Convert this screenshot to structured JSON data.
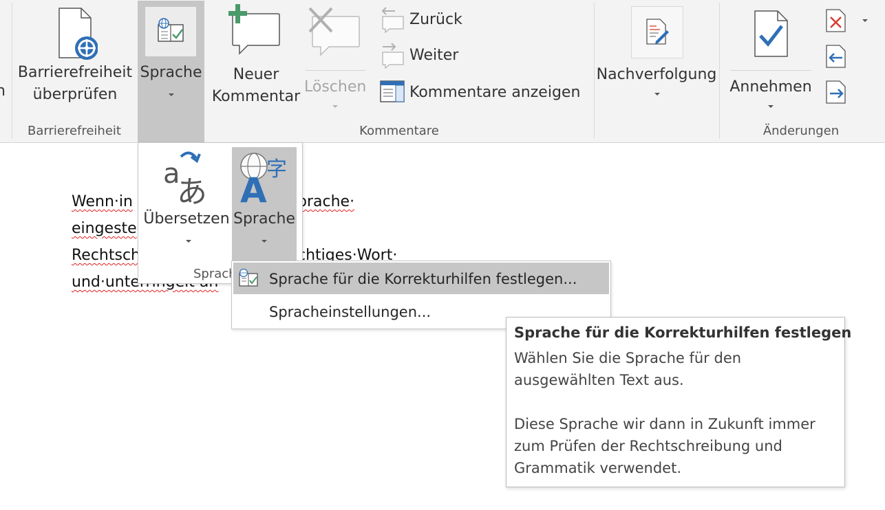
{
  "ribbon": {
    "barrierefreiheit": {
      "check_line1": "Barrierefreiheit",
      "check_line2": "überprüfen",
      "group": "Barrierefreiheit"
    },
    "sprache_button": "Sprache",
    "kommentare": {
      "new_line1": "Neuer",
      "new_line2": "Kommentar",
      "delete": "Löschen",
      "back": "Zurück",
      "next": "Weiter",
      "show": "Kommentare anzeigen",
      "group": "Kommentare"
    },
    "tracking": {
      "label": "Nachverfolgung"
    },
    "changes": {
      "accept": "Annehmen",
      "group": "Änderungen"
    }
  },
  "document": {
    "line1": "Wenn·in",
    "line1_end": "prache·",
    "line2": "eingeste",
    "line3": "Rechtsch",
    "line3_end": "chtiges·Wort·",
    "line4": "und·unterringelt·an"
  },
  "lang_panel": {
    "translate": "Übersetzen",
    "language": "Sprache",
    "group": "Sprach"
  },
  "menu": {
    "set_proofing": "Sprache für die Korrekturhilfen festlegen...",
    "settings": "Spracheinstellungen..."
  },
  "tooltip": {
    "title": "Sprache für die Korrekturhilfen festlegen",
    "line1": "Wählen Sie die Sprache für den",
    "line2": "ausgewählten Text aus.",
    "line3": "Diese Sprache wir dann in Zukunft immer",
    "line4": "zum Prüfen der Rechtschreibung und",
    "line5": "Grammatik verwendet."
  },
  "colors": {
    "accent_blue": "#2f6fb5",
    "selected_bg": "#c6c6c6",
    "comment_green": "#4a9a6a",
    "reject_red": "#d83b2f",
    "squiggle": "#e02020"
  }
}
